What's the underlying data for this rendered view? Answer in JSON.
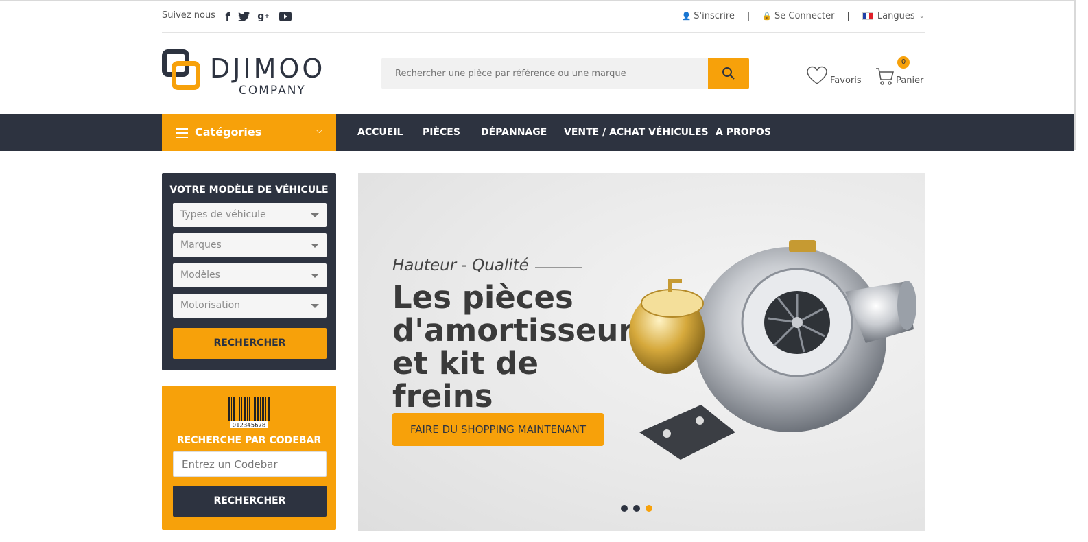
{
  "topbar": {
    "follow": "Suivez nous",
    "social": [
      "facebook-icon",
      "twitter-icon",
      "google-plus-icon",
      "youtube-icon"
    ],
    "register": "S'inscrire",
    "login": "Se Connecter",
    "languages": "Langues"
  },
  "logo": {
    "name": "DJIMOO",
    "sub": "COMPANY"
  },
  "search": {
    "placeholder": "Rechercher une pièce par référence ou une marque"
  },
  "header": {
    "favorites": "Favoris",
    "cart": "Panier",
    "cart_count": "0"
  },
  "nav": {
    "categories": "Catégories",
    "items": [
      "ACCUEIL",
      "PIÈCES",
      "DÉPANNAGE",
      "VENTE / ACHAT VÉHICULES",
      "A PROPOS"
    ]
  },
  "vehicle": {
    "title": "VOTRE MODÈLE DE VÉHICULE",
    "selects": [
      "Types de véhicule",
      "Marques",
      "Modèles",
      "Motorisation"
    ],
    "button": "RECHERCHER"
  },
  "codebar": {
    "number": "012345678",
    "title": "RECHERCHE PAR CODEBAR",
    "placeholder": "Entrez un Codebar",
    "button": "RECHERCHER"
  },
  "hero": {
    "tagline": "Hauteur - Qualité",
    "heading": "Les pièces d'amortisseurs et kit de freins",
    "cta": "FAIRE DU SHOPPING MAINTENANT",
    "slide_count": 3,
    "active_slide": 3
  },
  "colors": {
    "accent": "#f7a10a",
    "dark": "#2d3340"
  }
}
